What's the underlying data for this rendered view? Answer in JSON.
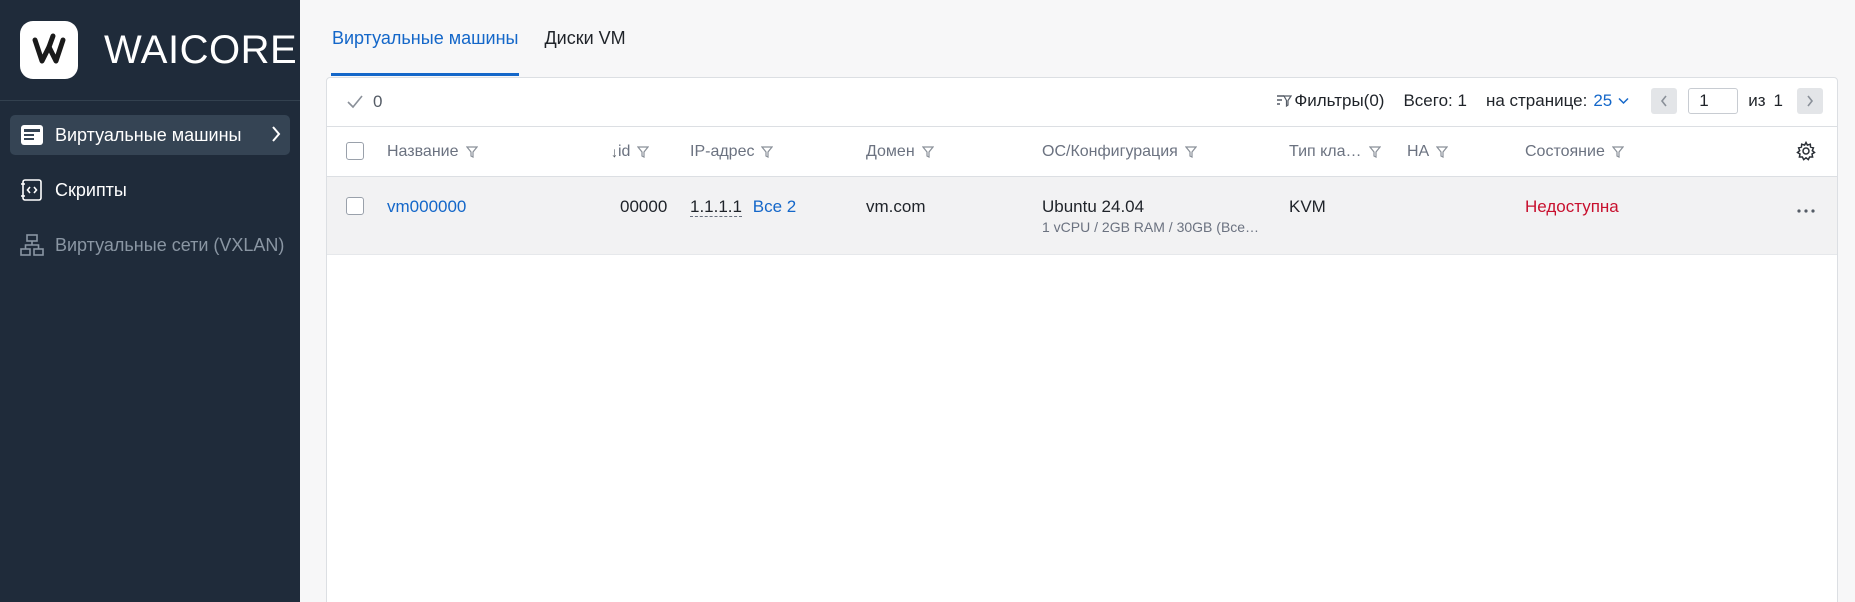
{
  "brand": {
    "name": "WAICORE"
  },
  "sidebar": {
    "items": [
      {
        "label": "Виртуальные машины",
        "active": true
      },
      {
        "label": "Скрипты",
        "active": false
      },
      {
        "label": "Виртуальные сети (VXLAN)",
        "disabled": true
      }
    ]
  },
  "tabs": [
    {
      "label": "Виртуальные машины",
      "active": true
    },
    {
      "label": "Диски VM",
      "active": false
    }
  ],
  "toolbar": {
    "selected_count": "0",
    "filters_label": "Фильтры(0)",
    "total_label": "Всего: 1",
    "per_page_label": "на странице:",
    "per_page_value": "25",
    "page_value": "1",
    "of_label": "из",
    "total_pages": "1"
  },
  "table": {
    "columns": [
      {
        "key": "name",
        "label": "Название"
      },
      {
        "key": "id",
        "label": "id",
        "sort": "↓"
      },
      {
        "key": "ip",
        "label": "IP-адрес"
      },
      {
        "key": "domain",
        "label": "Домен"
      },
      {
        "key": "os",
        "label": "ОС/Конфигурация"
      },
      {
        "key": "type",
        "label": "Тип кла…"
      },
      {
        "key": "ha",
        "label": "HA"
      },
      {
        "key": "state",
        "label": "Состояние"
      }
    ],
    "rows": [
      {
        "name": "vm000000",
        "id": "00000",
        "ip": "1.1.1.1",
        "ip_more": "Все 2",
        "domain": "vm.com",
        "os": "Ubuntu 24.04",
        "config": "1 vCPU / 2GB RAM / 30GB (Все…",
        "type": "KVM",
        "ha": "",
        "state": "Недоступна"
      }
    ]
  },
  "colors": {
    "sidebar_bg": "#1f2b3a",
    "accent": "#1467c9",
    "status_unavailable": "#c8102e"
  }
}
